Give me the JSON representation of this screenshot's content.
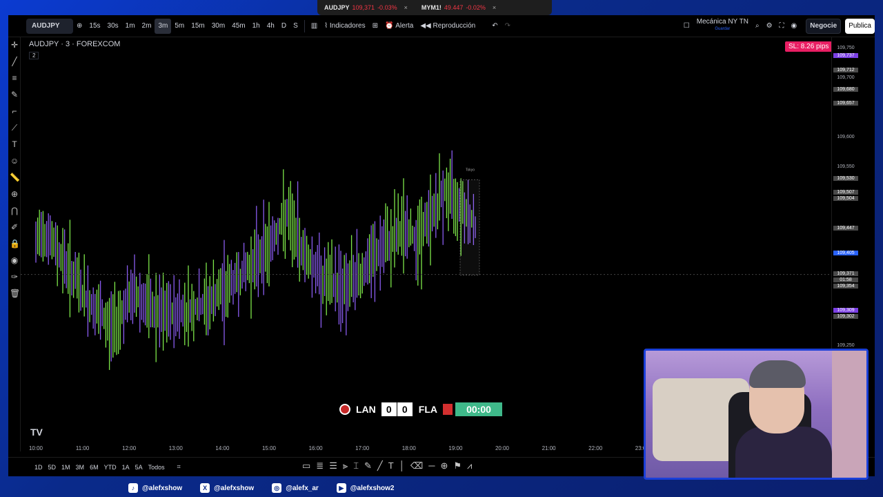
{
  "browser_tabs": [
    {
      "symbol": "AUDJPY",
      "price": "109,371",
      "change": "-0.03%",
      "close": "×"
    },
    {
      "symbol": "MYM1!",
      "price": "49.447",
      "change": "-0.02%",
      "close": "×"
    }
  ],
  "toolbar": {
    "symbol": "AUDJPY",
    "timeframes": [
      "15s",
      "30s",
      "1m",
      "2m",
      "3m",
      "5m",
      "15m",
      "30m",
      "45m",
      "1h",
      "4h",
      "D",
      "S"
    ],
    "active_timeframe": "3m",
    "indicators_label": "Indicadores",
    "alert_label": "Alerta",
    "replay_label": "Reproducción",
    "preset_name": "Mecánica NY TN",
    "preset_sub": "Guardar",
    "trade_label": "Negocie",
    "publish_label": "Publica"
  },
  "legend": {
    "title": "AUDJPY · 3 · FOREXCOM",
    "sub": "2"
  },
  "sl_badge": "SL: 8.26 pips",
  "chart_data": {
    "type": "candlestick",
    "symbol": "AUDJPY",
    "interval": "3",
    "x_ticks": [
      "10:00",
      "11:00",
      "12:00",
      "13:00",
      "14:00",
      "15:00",
      "16:00",
      "17:00",
      "18:00",
      "19:00",
      "20:00",
      "21:00",
      "22:00",
      "23:00"
    ],
    "y_ticks": [
      "109,750",
      "109,700",
      "109,600",
      "109,550",
      "109,250"
    ],
    "ylim": [
      109.25,
      109.76
    ],
    "price_labels": [
      {
        "value": "109,737",
        "style": "purple"
      },
      {
        "value": "109,712",
        "style": "box"
      },
      {
        "value": "109,680",
        "style": "box"
      },
      {
        "value": "109,657",
        "style": "box"
      },
      {
        "value": "109,530",
        "style": "box"
      },
      {
        "value": "109,507",
        "style": "box"
      },
      {
        "value": "109,504",
        "style": "box"
      },
      {
        "value": "109,447",
        "style": "box"
      },
      {
        "value": "109,405",
        "style": "blue"
      },
      {
        "value": "109,371",
        "style": "box"
      },
      {
        "value": "01:58",
        "style": "box"
      },
      {
        "value": "109,354",
        "style": "box"
      },
      {
        "value": "109,309",
        "style": "purple"
      },
      {
        "value": "109,302",
        "style": "box"
      }
    ],
    "session_label": "Tokyo",
    "last_price": 109.371,
    "series_path": [
      [
        0,
        109.32
      ],
      [
        30,
        109.45
      ],
      [
        60,
        109.4
      ],
      [
        95,
        109.33
      ],
      [
        130,
        109.28
      ],
      [
        165,
        109.34
      ],
      [
        200,
        109.3
      ],
      [
        235,
        109.31
      ],
      [
        270,
        109.32
      ],
      [
        300,
        109.35
      ],
      [
        330,
        109.38
      ],
      [
        360,
        109.42
      ],
      [
        385,
        109.47
      ],
      [
        410,
        109.41
      ],
      [
        440,
        109.36
      ],
      [
        470,
        109.35
      ],
      [
        500,
        109.38
      ],
      [
        530,
        109.42
      ],
      [
        555,
        109.45
      ],
      [
        575,
        109.43
      ],
      [
        595,
        109.47
      ],
      [
        615,
        109.51
      ],
      [
        640,
        109.49
      ],
      [
        660,
        109.45
      ]
    ]
  },
  "bottom": {
    "ranges": [
      "1D",
      "5D",
      "1M",
      "3M",
      "6M",
      "YTD",
      "1A",
      "5A",
      "Todos"
    ]
  },
  "scoreboard": {
    "home": "LAN",
    "home_score": "0",
    "away_score": "0",
    "away": "FLA",
    "clock": "00:00"
  },
  "social": [
    {
      "icon": "tiktok-icon",
      "glyph": "♪",
      "handle": "@alefxshow"
    },
    {
      "icon": "x-icon",
      "glyph": "X",
      "handle": "@alefxshow"
    },
    {
      "icon": "instagram-icon",
      "glyph": "◎",
      "handle": "@alefx_ar"
    },
    {
      "icon": "youtube-icon",
      "glyph": "▶",
      "handle": "@alefxshow2"
    }
  ]
}
